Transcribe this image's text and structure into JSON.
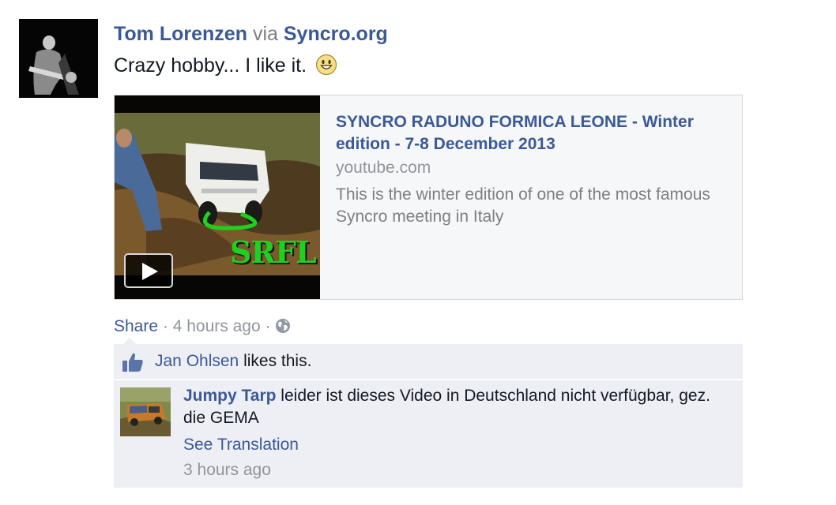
{
  "post": {
    "author": "Tom Lorenzen",
    "via_label": "via",
    "app_name": "Syncro.org",
    "message": "Crazy hobby... I like it.",
    "emoji": "smiley-icon"
  },
  "attachment": {
    "title": "SYNCRO RADUNO FORMICA LEONE - Winter edition - 7-8 December 2013",
    "source": "youtube.com",
    "description": "This is the winter edition of one of the most famous Syncro meeting in Italy",
    "thumbnail_overlay_text": "SRFL"
  },
  "meta": {
    "share_label": "Share",
    "separator": "·",
    "timestamp": "4 hours ago",
    "privacy_icon": "globe-icon"
  },
  "likes": {
    "liker": "Jan Ohlsen",
    "suffix": " likes this."
  },
  "comments": [
    {
      "author": "Jumpy Tarp",
      "text": " leider ist dieses Video in Deutschland nicht verfügbar, gez. die GEMA",
      "translation_label": "See Translation",
      "timestamp": "3 hours ago"
    }
  ],
  "colors": {
    "link": "#3b5998",
    "secondary_text": "#90949c",
    "ufi_background": "#edeff4",
    "thumbnail_text_green": "#1fd11f"
  }
}
